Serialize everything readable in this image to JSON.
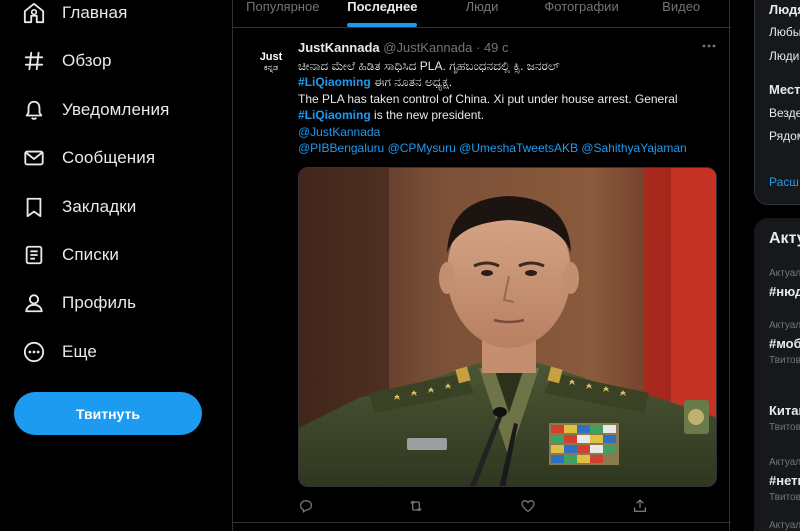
{
  "nav": {
    "items": [
      {
        "label": "Главная",
        "icon": "home-icon"
      },
      {
        "label": "Обзор",
        "icon": "hashtag-icon"
      },
      {
        "label": "Уведомления",
        "icon": "bell-icon"
      },
      {
        "label": "Сообщения",
        "icon": "envelope-icon"
      },
      {
        "label": "Закладки",
        "icon": "bookmark-icon"
      },
      {
        "label": "Списки",
        "icon": "list-icon"
      },
      {
        "label": "Профиль",
        "icon": "person-icon"
      },
      {
        "label": "Еще",
        "icon": "more-circle-icon"
      }
    ],
    "tweet_button": "Твитнуть"
  },
  "tabs": [
    {
      "label": "Популярное",
      "active": false
    },
    {
      "label": "Последнее",
      "active": true
    },
    {
      "label": "Люди",
      "active": false
    },
    {
      "label": "Фотографии",
      "active": false
    },
    {
      "label": "Видео",
      "active": false
    }
  ],
  "tweet": {
    "avatar_line1": "Just",
    "avatar_line2": "ಕನ್ನಡ",
    "author_name": "JustKannada",
    "author_handle": "@JustKannada",
    "dot": "·",
    "time": "49 с",
    "line1": "ಚೀನಾದ ಮೇಲೆ ಹಿಡಿತ ಸಾಧಿಸಿದ PLA. ಗೃಹಬಂಧನದಲ್ಲಿ ಕ್ಸಿ. ಜನರಲ್",
    "hashtag1": "#LiQiaoming",
    "line2_rest": " ಈಗ ನೂತನ ಅಧ್ಯಕ್ಷ.",
    "line3": "The PLA has taken control of China. Xi put under house arrest. General",
    "hashtag2": "#LiQiaoming",
    "line4_rest": " is the new president.",
    "mention1": "@JustKannada",
    "mentions2": "@PIBBengaluru @CPMysuru @UmeshaTweetsAKB @SahithyaYajaman"
  },
  "right": {
    "card1_rows": [
      "Людя",
      "Любы",
      "Люди",
      "Мест",
      "Везде",
      "Рядом",
      "Расш"
    ],
    "trends_title": "Акту",
    "trends": [
      {
        "context": "Актуал",
        "name": "#нюд",
        "count": ""
      },
      {
        "context": "Актуал",
        "name": "#моб",
        "count": "Твитов"
      },
      {
        "context": "",
        "name": "Китай",
        "count": "Твитов"
      },
      {
        "context": "Актуал",
        "name": "#нетн",
        "count": "Твитов"
      },
      {
        "context": "Актуал",
        "name": "",
        "count": ""
      }
    ]
  },
  "colors": {
    "accent": "#1d9bf0",
    "background": "#000000",
    "border": "#2f3336",
    "muted": "#71767b"
  }
}
